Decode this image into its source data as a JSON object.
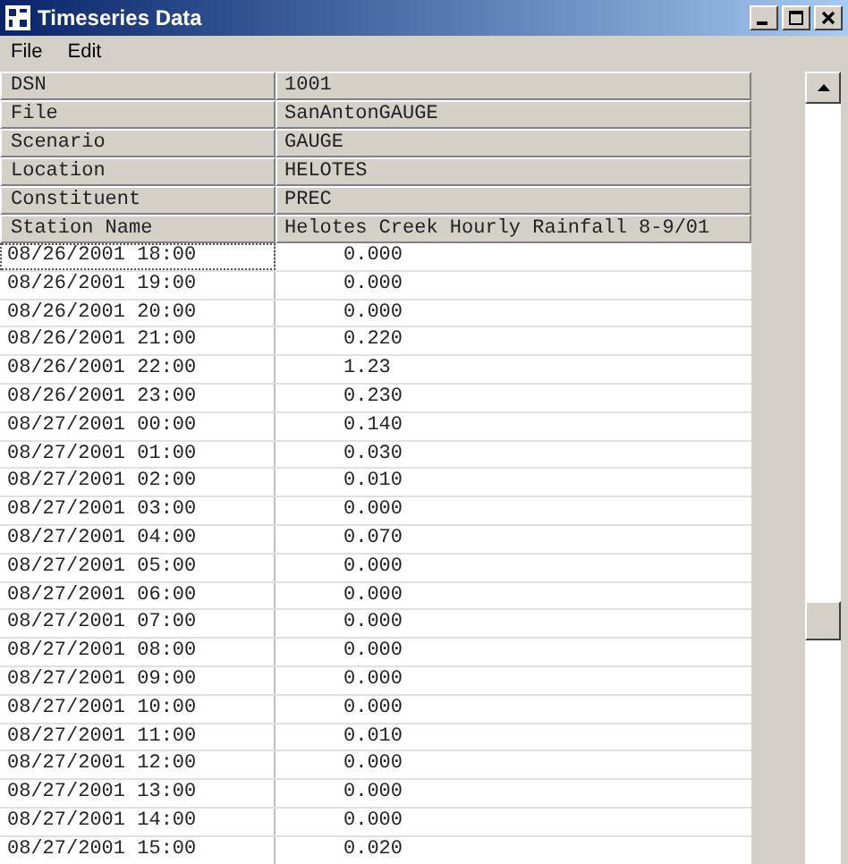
{
  "window": {
    "title": "Timeseries Data"
  },
  "menu": [
    "File",
    "Edit"
  ],
  "attributes": [
    {
      "label": "DSN",
      "value": "1001"
    },
    {
      "label": "File",
      "value": "SanAntonGAUGE"
    },
    {
      "label": "Scenario",
      "value": "GAUGE"
    },
    {
      "label": "Location",
      "value": "HELOTES"
    },
    {
      "label": "Constituent",
      "value": "PREC"
    },
    {
      "label": "Station Name",
      "value": "Helotes Creek Hourly Rainfall 8-9/01"
    }
  ],
  "rows": [
    {
      "date": "08/26/2001 18:00",
      "value": "0.000",
      "selected": true
    },
    {
      "date": "08/26/2001 19:00",
      "value": "0.000",
      "selected": false
    },
    {
      "date": "08/26/2001 20:00",
      "value": "0.000",
      "selected": false
    },
    {
      "date": "08/26/2001 21:00",
      "value": "0.220",
      "selected": false
    },
    {
      "date": "08/26/2001 22:00",
      "value": "1.23",
      "selected": false
    },
    {
      "date": "08/26/2001 23:00",
      "value": "0.230",
      "selected": false
    },
    {
      "date": "08/27/2001 00:00",
      "value": "0.140",
      "selected": false
    },
    {
      "date": "08/27/2001 01:00",
      "value": "0.030",
      "selected": false
    },
    {
      "date": "08/27/2001 02:00",
      "value": "0.010",
      "selected": false
    },
    {
      "date": "08/27/2001 03:00",
      "value": "0.000",
      "selected": false
    },
    {
      "date": "08/27/2001 04:00",
      "value": "0.070",
      "selected": false
    },
    {
      "date": "08/27/2001 05:00",
      "value": "0.000",
      "selected": false
    },
    {
      "date": "08/27/2001 06:00",
      "value": "0.000",
      "selected": false
    },
    {
      "date": "08/27/2001 07:00",
      "value": "0.000",
      "selected": false
    },
    {
      "date": "08/27/2001 08:00",
      "value": "0.000",
      "selected": false
    },
    {
      "date": "08/27/2001 09:00",
      "value": "0.000",
      "selected": false
    },
    {
      "date": "08/27/2001 10:00",
      "value": "0.000",
      "selected": false
    },
    {
      "date": "08/27/2001 11:00",
      "value": "0.010",
      "selected": false
    },
    {
      "date": "08/27/2001 12:00",
      "value": "0.000",
      "selected": false
    },
    {
      "date": "08/27/2001 13:00",
      "value": "0.000",
      "selected": false
    },
    {
      "date": "08/27/2001 14:00",
      "value": "0.000",
      "selected": false
    },
    {
      "date": "08/27/2001 15:00",
      "value": "0.020",
      "selected": false
    }
  ]
}
